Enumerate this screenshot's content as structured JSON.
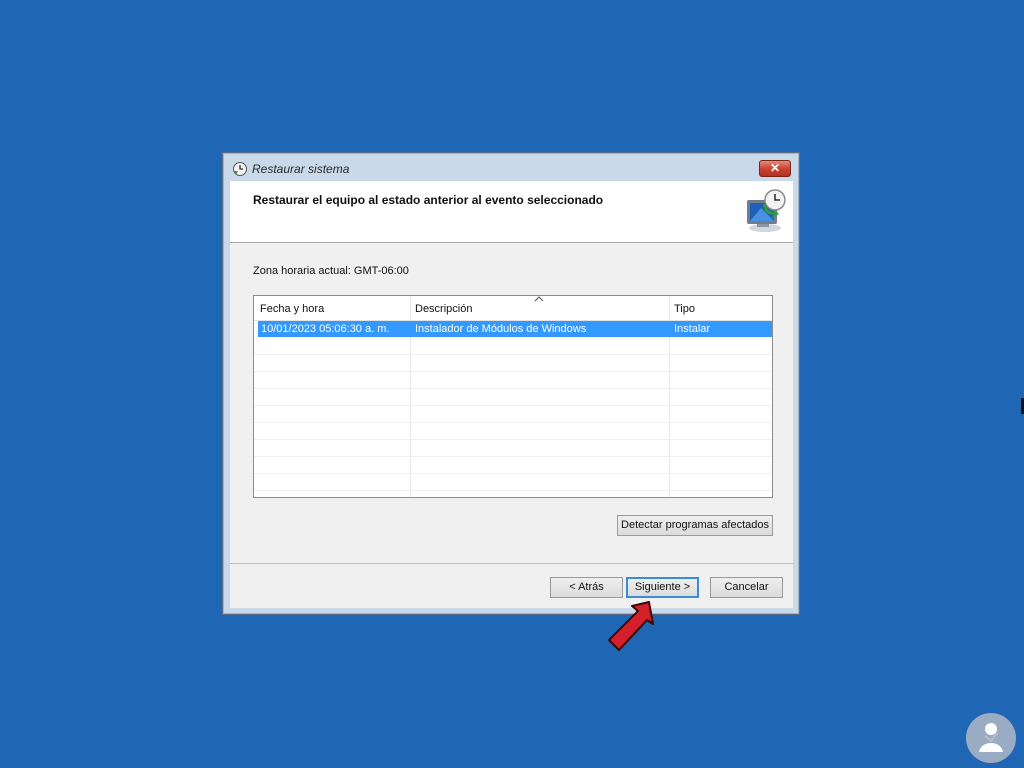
{
  "window": {
    "title": "Restaurar sistema",
    "close_glyph": "✕",
    "header_title": "Restaurar el equipo al estado anterior al evento seleccionado",
    "icon": "system-restore-icon"
  },
  "timezone_label": "Zona horaria actual: GMT-06:00",
  "list": {
    "columns": [
      "Fecha y hora",
      "Descripción",
      "Tipo"
    ],
    "sorted_column": "Descripción",
    "rows": [
      {
        "date": "10/01/2023 05:06:30 a. m.",
        "description": "Instalador de Módulos de Windows",
        "type": "Instalar",
        "selected": true
      }
    ]
  },
  "buttons": {
    "detect": "Detectar programas afectados",
    "back": "< Atrás",
    "next": "Siguiente >",
    "cancel": "Cancelar"
  },
  "colors": {
    "desktop": "#1f67b4",
    "selection": "#3399ff",
    "arrow": "#d4202a"
  }
}
